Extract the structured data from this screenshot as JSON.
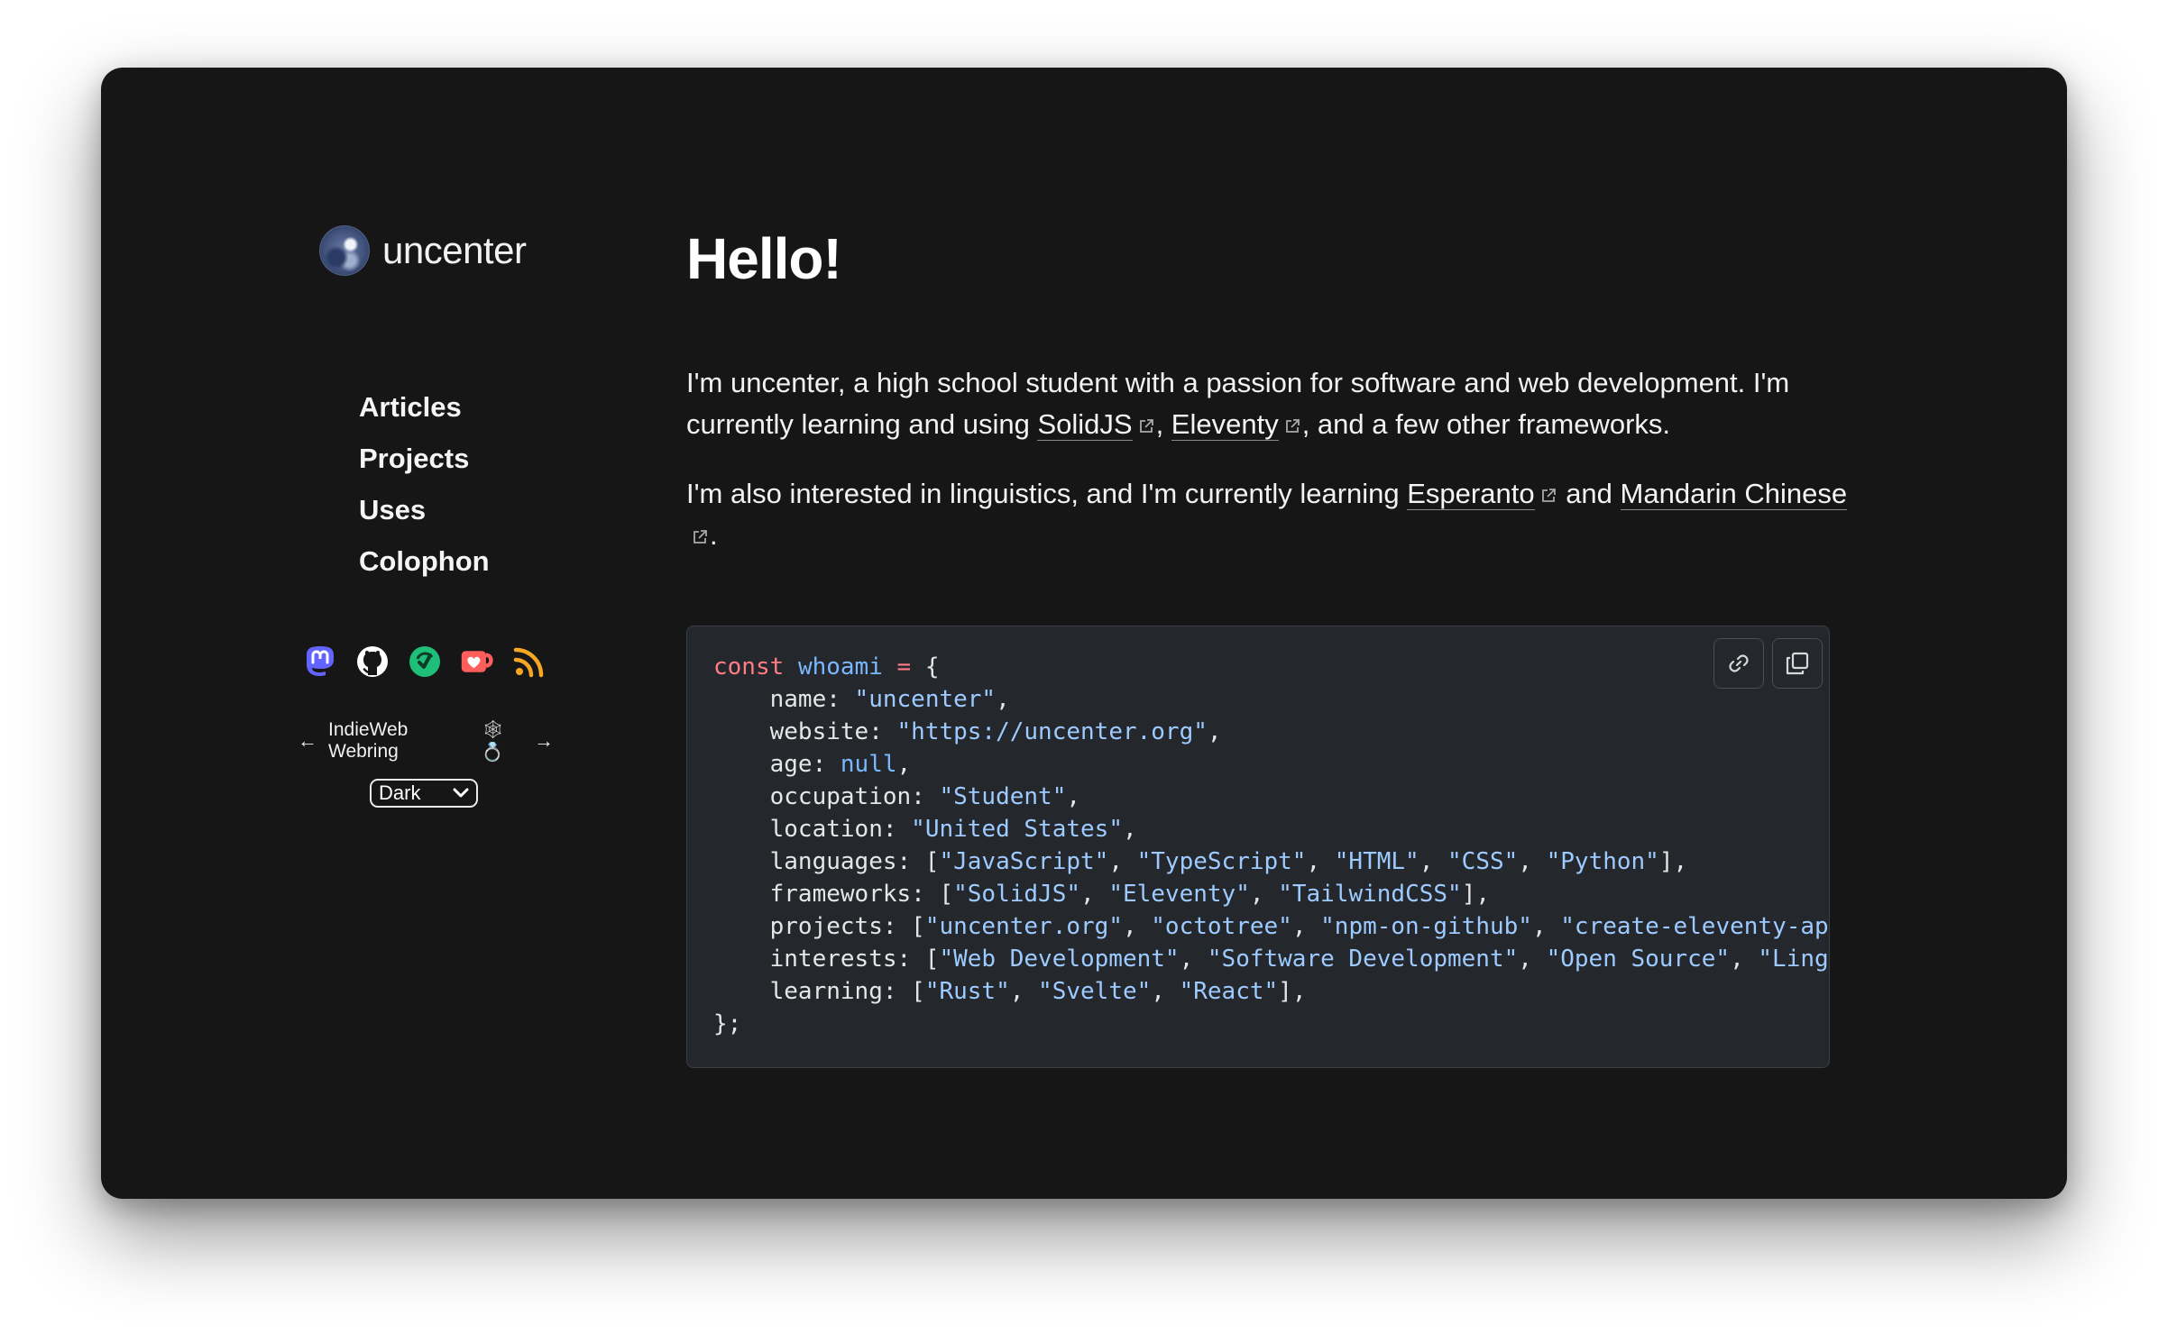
{
  "site": {
    "name": "uncenter"
  },
  "nav": {
    "items": [
      {
        "label": "Articles"
      },
      {
        "label": "Projects"
      },
      {
        "label": "Uses"
      },
      {
        "label": "Colophon"
      }
    ]
  },
  "socials": [
    {
      "icon": "mastodon-icon",
      "color": "#6364ff"
    },
    {
      "icon": "github-icon",
      "color": "#ffffff"
    },
    {
      "icon": "codementor-icon",
      "color": "#1fbf7a"
    },
    {
      "icon": "kofi-icon",
      "color": "#ff5e5b"
    },
    {
      "icon": "rss-icon",
      "color": "#f5a623"
    }
  ],
  "webring": {
    "prev": "←",
    "label": "IndieWeb Webring",
    "ring": "🕸💍",
    "next": "→"
  },
  "theme": {
    "selected": "Dark"
  },
  "main": {
    "title": "Hello!",
    "p1_a": "I'm uncenter, a high school student with a passion for software and web development. I'm currently learning and using ",
    "link_solidjs": "SolidJS",
    "p1_b": ", ",
    "link_eleventy": "Eleventy",
    "p1_c": ", and a few other frameworks.",
    "p2_a": "I'm also interested in linguistics, and I'm currently learning ",
    "link_esperanto": "Esperanto",
    "p2_b": " and ",
    "link_mandarin": "Mandarin Chinese",
    "p2_c": "."
  },
  "code": {
    "keyword": "const",
    "var_name": "whoami",
    "op": "=",
    "open": "{",
    "close": "};",
    "name_key": "name: ",
    "name_val": "\"uncenter\"",
    "website_key": "website: ",
    "website_val": "\"https://uncenter.org\"",
    "age_key": "age: ",
    "age_val": "null",
    "occupation_key": "occupation: ",
    "occupation_val": "\"Student\"",
    "location_key": "location: ",
    "location_val": "\"United States\"",
    "languages_key": "languages: [",
    "languages_vals": [
      "\"JavaScript\"",
      "\"TypeScript\"",
      "\"HTML\"",
      "\"CSS\"",
      "\"Python\""
    ],
    "frameworks_key": "frameworks: [",
    "frameworks_vals": [
      "\"SolidJS\"",
      "\"Eleventy\"",
      "\"TailwindCSS\""
    ],
    "projects_key": "projects: [",
    "projects_vals": [
      "\"uncenter.org\"",
      "\"octotree\"",
      "\"npm-on-github\"",
      "\"create-eleventy-app\"",
      "\""
    ],
    "interests_key": "interests: [",
    "interests_vals": [
      "\"Web Development\"",
      "\"Software Development\"",
      "\"Open Source\"",
      "\"Linguisti"
    ],
    "learning_key": "learning: [",
    "learning_vals": [
      "\"Rust\"",
      "\"Svelte\"",
      "\"React\""
    ]
  },
  "colors": {
    "background": "#161617",
    "code_bg": "#24272c",
    "keyword": "#ff7b86",
    "string": "#9ecbff"
  }
}
